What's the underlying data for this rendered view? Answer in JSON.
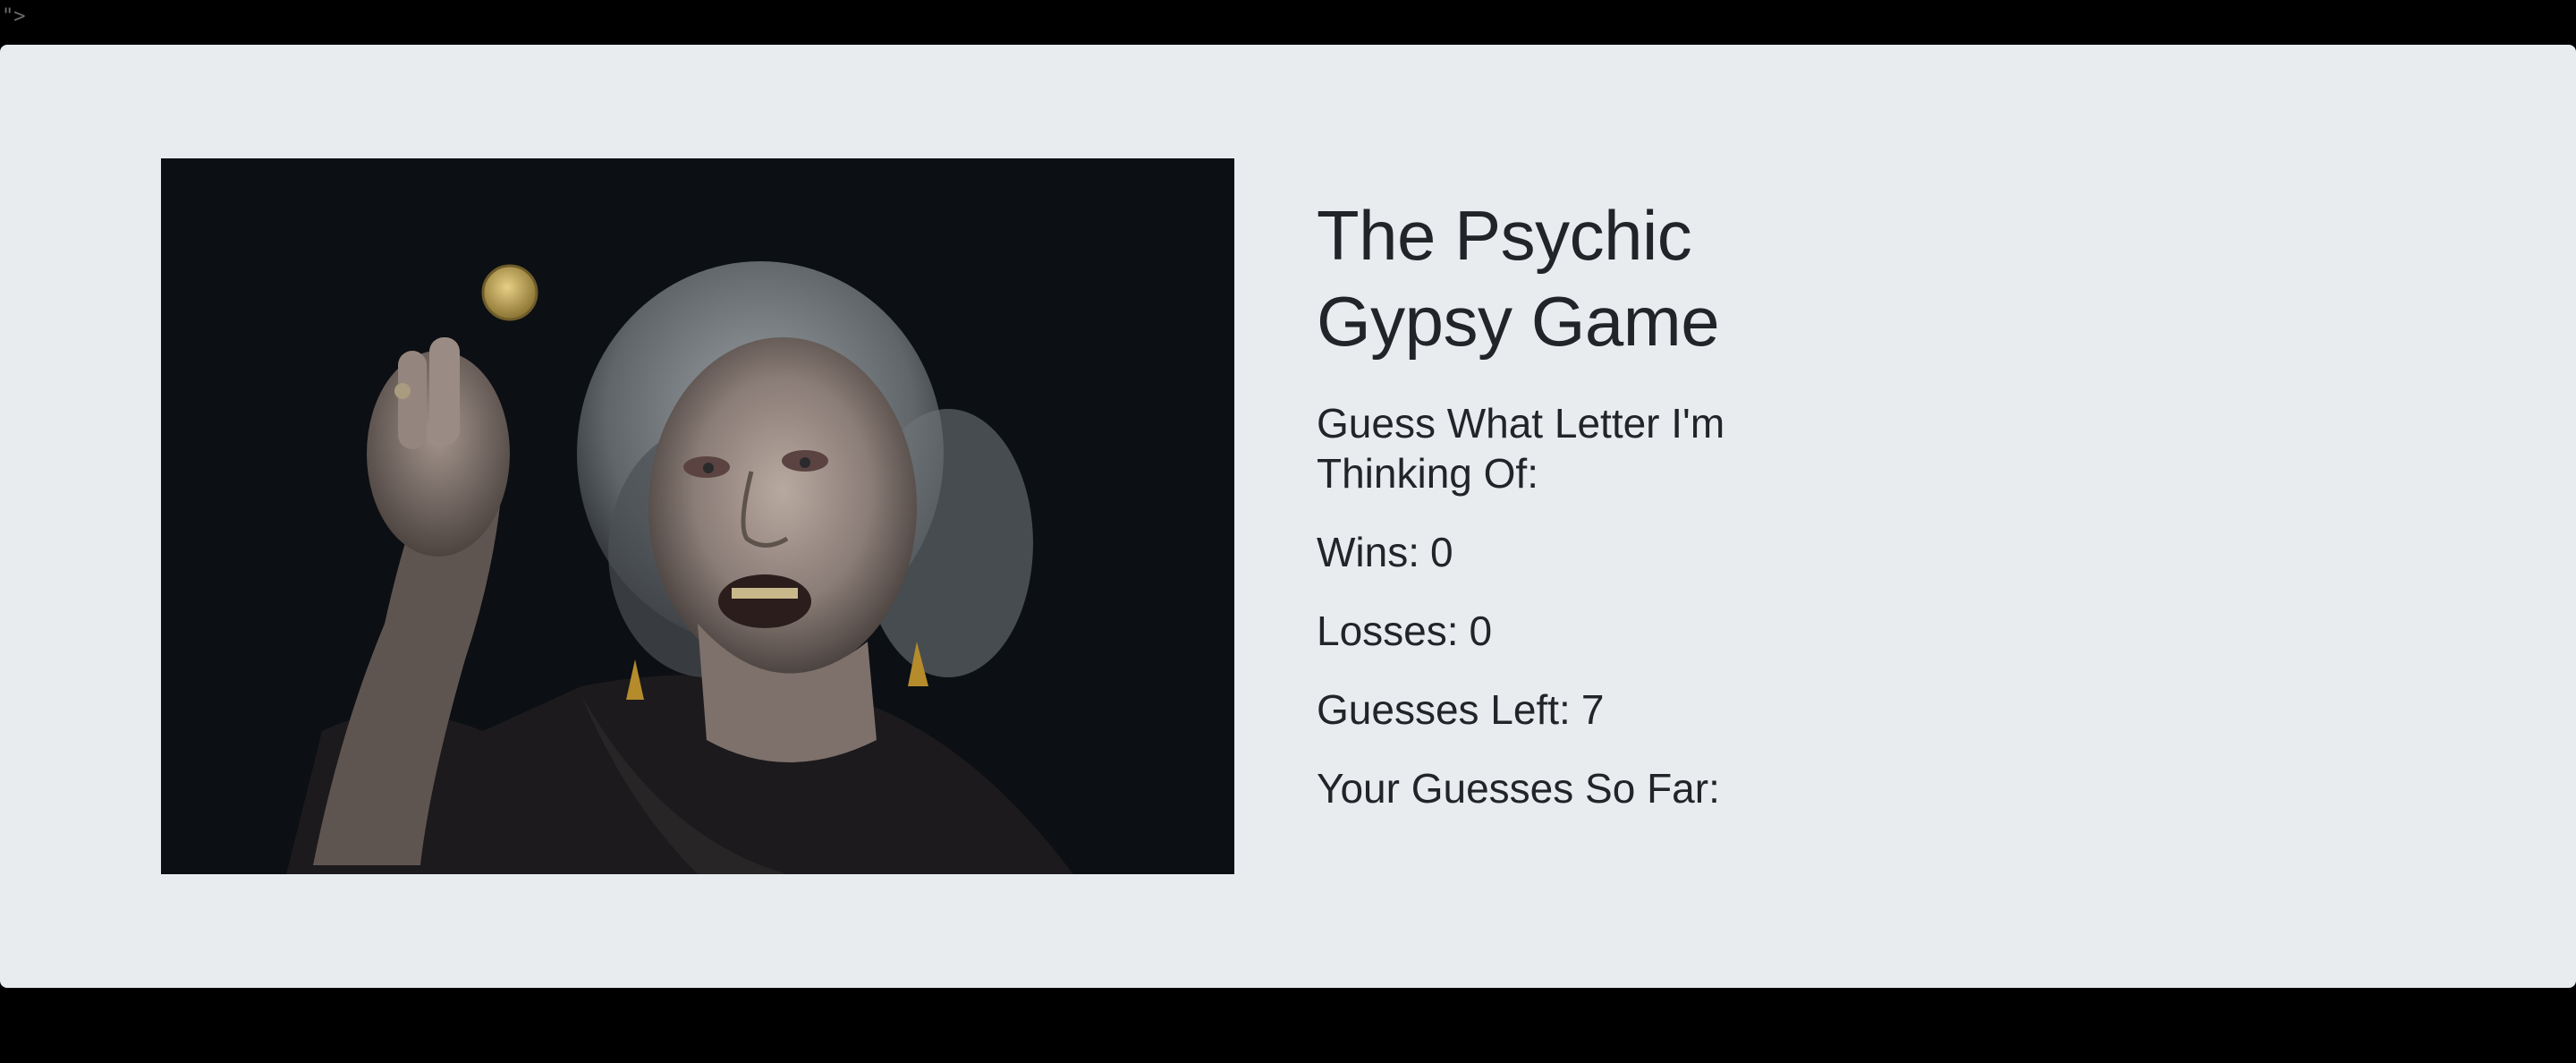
{
  "stray_text": "\">",
  "game": {
    "title": "The Psychic Gypsy Game",
    "prompt": "Guess What Letter I'm Thinking Of:",
    "wins_label": "Wins:",
    "wins": "0",
    "losses_label": "Losses:",
    "losses": "0",
    "guesses_left_label": "Guesses Left:",
    "guesses_left": "7",
    "guesses_so_far_label": "Your Guesses So Far:",
    "guesses_so_far": ""
  },
  "colors": {
    "page_background": "#000000",
    "panel_background": "#e9ecef",
    "text": "#212529"
  },
  "image": {
    "subject": "elderly woman holding up a gold coin"
  }
}
